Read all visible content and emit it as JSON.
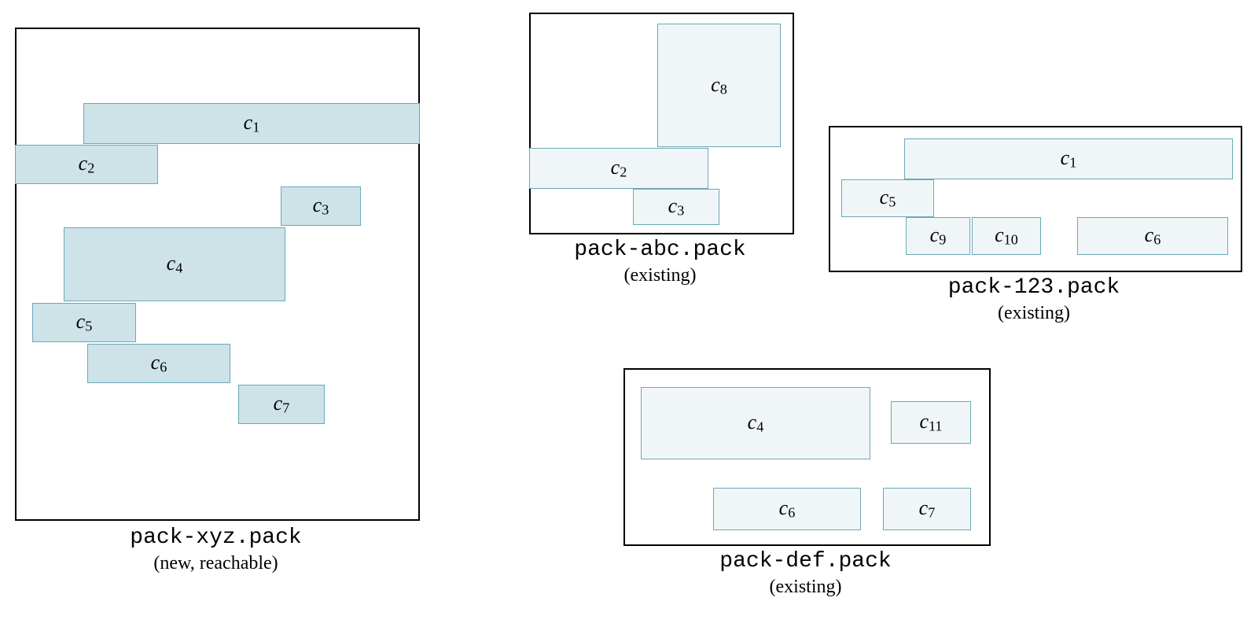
{
  "packs": {
    "xyz": {
      "filename": "pack-xyz.pack",
      "status": "(new, reachable)",
      "chunks": {
        "c1": "c",
        "c2": "c",
        "c3": "c",
        "c4": "c",
        "c5": "c",
        "c6": "c",
        "c7": "c"
      },
      "subs": {
        "c1": "1",
        "c2": "2",
        "c3": "3",
        "c4": "4",
        "c5": "5",
        "c6": "6",
        "c7": "7"
      }
    },
    "abc": {
      "filename": "pack-abc.pack",
      "status": "(existing)",
      "chunks": {
        "c8": "c",
        "c2": "c",
        "c3": "c"
      },
      "subs": {
        "c8": "8",
        "c2": "2",
        "c3": "3"
      }
    },
    "p123": {
      "filename": "pack-123.pack",
      "status": "(existing)",
      "chunks": {
        "c1": "c",
        "c5": "c",
        "c9": "c",
        "c10": "c",
        "c6": "c"
      },
      "subs": {
        "c1": "1",
        "c5": "5",
        "c9": "9",
        "c10": "10",
        "c6": "6"
      }
    },
    "def": {
      "filename": "pack-def.pack",
      "status": "(existing)",
      "chunks": {
        "c4": "c",
        "c11": "c",
        "c6": "c",
        "c7": "c"
      },
      "subs": {
        "c4": "4",
        "c11": "11",
        "c6": "6",
        "c7": "7"
      }
    }
  }
}
